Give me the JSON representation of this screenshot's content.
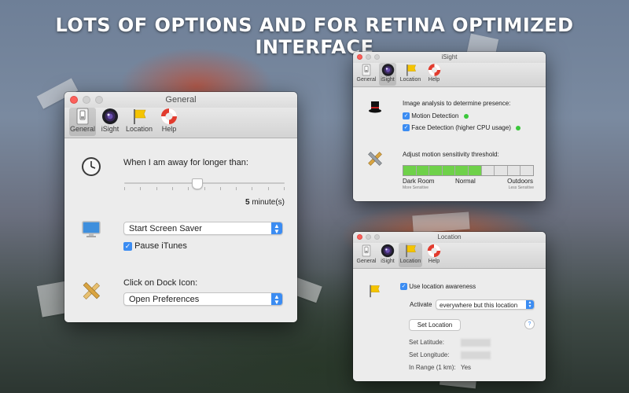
{
  "headline": "LOTS OF OPTIONS AND FOR RETINA OPTIMIZED INTERFACE",
  "toolbar_tabs": [
    "General",
    "iSight",
    "Location",
    "Help"
  ],
  "general": {
    "title": "General",
    "away_label": "When I am away for longer than:",
    "slider_value": "5",
    "slider_unit": "minute(s)",
    "slider_fraction": 0.45,
    "action_select": "Start Screen Saver",
    "pause_itunes_label": "Pause iTunes",
    "pause_itunes_checked": true,
    "dock_label": "Click on Dock Icon:",
    "dock_select": "Open Preferences"
  },
  "isight": {
    "title": "iSight",
    "analysis_label": "Image analysis to determine presence:",
    "motion_label": "Motion Detection",
    "face_label": "Face Detection (higher CPU usage)",
    "threshold_label": "Adjust motion sensitivity threshold:",
    "threshold_segments_total": 10,
    "threshold_segments_filled": 6,
    "scale_left": "Dark Room",
    "scale_left_sub": "More Sensitive",
    "scale_mid": "Normal",
    "scale_right": "Outdoors",
    "scale_right_sub": "Less Sensitive"
  },
  "location": {
    "title": "Location",
    "use_location_label": "Use location awareness",
    "activate_label": "Activate",
    "activate_select": "everywhere but this location",
    "set_location_button": "Set Location",
    "help_button": "?",
    "latitude_label": "Set Latitude:",
    "longitude_label": "Set Longitude:",
    "range_label": "In Range (1 km):",
    "range_value": "Yes"
  },
  "colors": {
    "accent": "#3b8cf2",
    "status_green": "#3bc73b",
    "threshold_fill": "#6fd14a"
  }
}
